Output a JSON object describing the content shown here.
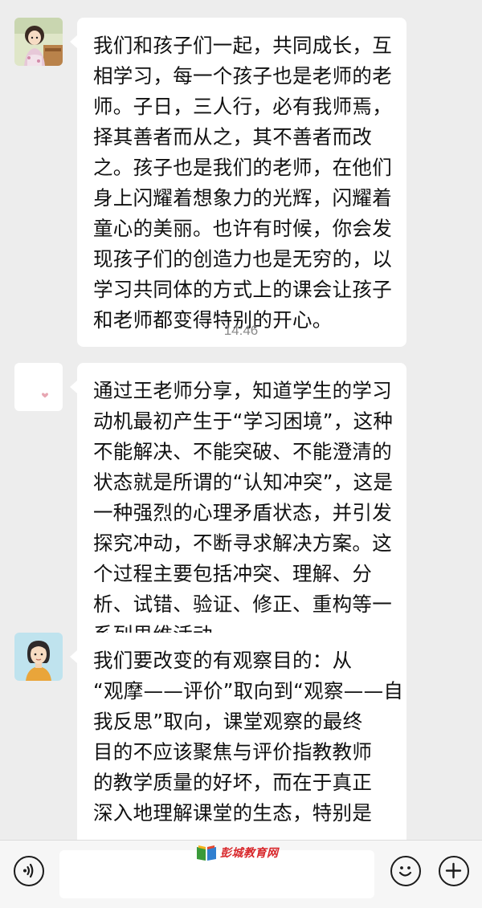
{
  "colors": {
    "background": "#ededed",
    "bubble": "#ffffff",
    "timestamp": "#8a8a8a",
    "watermark": "#d8262a"
  },
  "messages": [
    {
      "avatar": "girl-cartoon-avatar",
      "lines": [
        "我们和孩子们一起，共同成长，互",
        "相学习，每一个孩子也是老师的老",
        "师。子日，三人行，必有我师焉，",
        "择其善者而从之，其不善者而改",
        "之。孩子也是我们的老师，在他们",
        "身上闪耀着想象力的光辉，闪耀着",
        "童心的美丽。也许有时候，你会发",
        "现孩子们的创造力也是无穷的，以",
        "学习共同体的方式上的课会让孩子",
        "和老师都变得特别的开心。"
      ]
    },
    {
      "avatar": "heart-avatar",
      "lines": [
        "通过王老师分享，知道学生的学习",
        "动机最初产生于“学习困境”，这种",
        "不能解决、不能突破、不能澄清的",
        "状态就是所谓的“认知冲突”，这是",
        "一种强烈的心理矛盾状态，并引发",
        "探究冲动，不断寻求解决方案。这",
        "个过程主要包括冲突、理解、分",
        "析、试错、验证、修正、重构等一",
        "系列思维活动。"
      ]
    },
    {
      "avatar": "woman-cartoon-avatar",
      "lines": [
        "我们要改变的有观察目的：从",
        "“观摩——评价”取向到“观察——自",
        "我反思”取向，课堂观察的最终",
        "目的不应该聚焦与评价指教教师",
        "的教学质量的好坏，而在于真正",
        "深入地理解课堂的生态，特别是"
      ]
    }
  ],
  "timestamp": "14:46",
  "input_bar": {
    "voice_icon": "voice-icon",
    "emoji_icon": "emoji-icon",
    "plus_icon": "plus-icon"
  },
  "watermark": {
    "text": "彭城教育网",
    "logo": "book-logo-icon"
  }
}
